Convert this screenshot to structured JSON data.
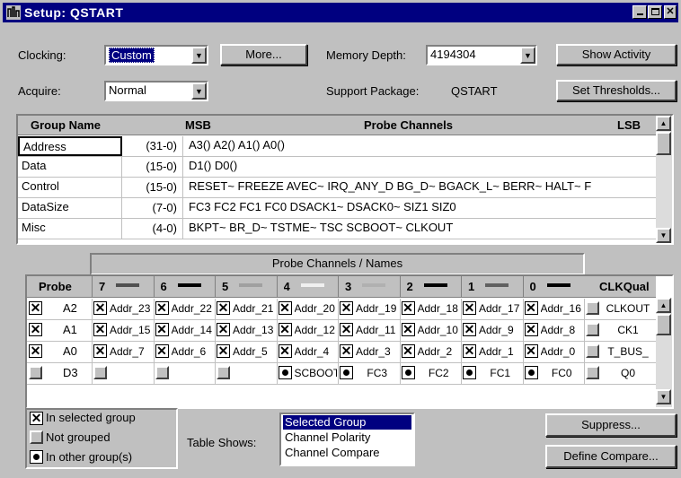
{
  "window": {
    "title": "Setup: QSTART"
  },
  "toolbar": {
    "clocking_label": "Clocking:",
    "clocking_value": "Custom",
    "more_button": "More...",
    "memory_depth_label": "Memory Depth:",
    "memory_depth_value": "4194304",
    "show_activity_button": "Show Activity",
    "acquire_label": "Acquire:",
    "acquire_value": "Normal",
    "support_package_label": "Support Package:",
    "support_package_value": "QSTART",
    "set_thresholds_button": "Set Thresholds..."
  },
  "group_table": {
    "headers": {
      "group_name": "Group Name",
      "msb": "MSB",
      "probe_channels": "Probe Channels",
      "lsb": "LSB"
    },
    "rows": [
      {
        "name": "Address",
        "range": "(31-0)",
        "channels": "A3() A2() A1() A0()"
      },
      {
        "name": "Data",
        "range": "(15-0)",
        "channels": "D1() D0()"
      },
      {
        "name": "Control",
        "range": "(15-0)",
        "channels": "RESET~ FREEZE AVEC~ IRQ_ANY_D BG_D~ BGACK_L~ BERR~ HALT~ F"
      },
      {
        "name": "DataSize",
        "range": "(7-0)",
        "channels": "FC3 FC2 FC1 FC0 DSACK1~ DSACK0~ SIZ1 SIZ0"
      },
      {
        "name": "Misc",
        "range": "(4-0)",
        "channels": "BKPT~ BR_D~ TSTME~ TSC SCBOOT~ CLKOUT"
      }
    ]
  },
  "probe_table": {
    "caption": "Probe Channels / Names",
    "probe_header": "Probe",
    "clkqual_header": "CLKQual",
    "columns": [
      {
        "label": "7",
        "swatch": "#505050"
      },
      {
        "label": "6",
        "swatch": "#000000"
      },
      {
        "label": "5",
        "swatch": "#a0a0a0"
      },
      {
        "label": "4",
        "swatch": "#f0f0f0"
      },
      {
        "label": "3",
        "swatch": "#b0b0b0"
      },
      {
        "label": "2",
        "swatch": "#000000"
      },
      {
        "label": "1",
        "swatch": "#606060"
      },
      {
        "label": "0",
        "swatch": "#000000"
      }
    ],
    "rows": [
      {
        "state": "x",
        "probe": "A2",
        "clk": "CLKOUT",
        "cells": [
          {
            "s": "x",
            "t": "Addr_23"
          },
          {
            "s": "x",
            "t": "Addr_22"
          },
          {
            "s": "x",
            "t": "Addr_21"
          },
          {
            "s": "x",
            "t": "Addr_20"
          },
          {
            "s": "x",
            "t": "Addr_19"
          },
          {
            "s": "x",
            "t": "Addr_18"
          },
          {
            "s": "x",
            "t": "Addr_17"
          },
          {
            "s": "x",
            "t": "Addr_16"
          }
        ]
      },
      {
        "state": "x",
        "probe": "A1",
        "clk": "CK1",
        "cells": [
          {
            "s": "x",
            "t": "Addr_15"
          },
          {
            "s": "x",
            "t": "Addr_14"
          },
          {
            "s": "x",
            "t": "Addr_13"
          },
          {
            "s": "x",
            "t": "Addr_12"
          },
          {
            "s": "x",
            "t": "Addr_11"
          },
          {
            "s": "x",
            "t": "Addr_10"
          },
          {
            "s": "x",
            "t": "Addr_9"
          },
          {
            "s": "x",
            "t": "Addr_8"
          }
        ]
      },
      {
        "state": "x",
        "probe": "A0",
        "clk": "T_BUS_",
        "cells": [
          {
            "s": "x",
            "t": "Addr_7"
          },
          {
            "s": "x",
            "t": "Addr_6"
          },
          {
            "s": "x",
            "t": "Addr_5"
          },
          {
            "s": "x",
            "t": "Addr_4"
          },
          {
            "s": "x",
            "t": "Addr_3"
          },
          {
            "s": "x",
            "t": "Addr_2"
          },
          {
            "s": "x",
            "t": "Addr_1"
          },
          {
            "s": "x",
            "t": "Addr_0"
          }
        ]
      },
      {
        "state": "empty",
        "probe": "D3",
        "clk": "Q0",
        "cells": [
          {
            "s": "empty",
            "t": ""
          },
          {
            "s": "empty",
            "t": ""
          },
          {
            "s": "empty",
            "t": ""
          },
          {
            "s": "dot",
            "t": "SCBOOT"
          },
          {
            "s": "dot",
            "t": "FC3"
          },
          {
            "s": "dot",
            "t": "FC2"
          },
          {
            "s": "dot",
            "t": "FC1"
          },
          {
            "s": "dot",
            "t": "FC0"
          }
        ]
      }
    ]
  },
  "legend": {
    "selected": "In selected group",
    "not_grouped": "Not grouped",
    "other": "In other group(s)"
  },
  "table_shows": {
    "label": "Table Shows:",
    "options": [
      "Selected Group",
      "Channel Polarity",
      "Channel Compare"
    ],
    "selected_index": 0
  },
  "buttons": {
    "suppress": "Suppress...",
    "define_compare": "Define Compare..."
  }
}
